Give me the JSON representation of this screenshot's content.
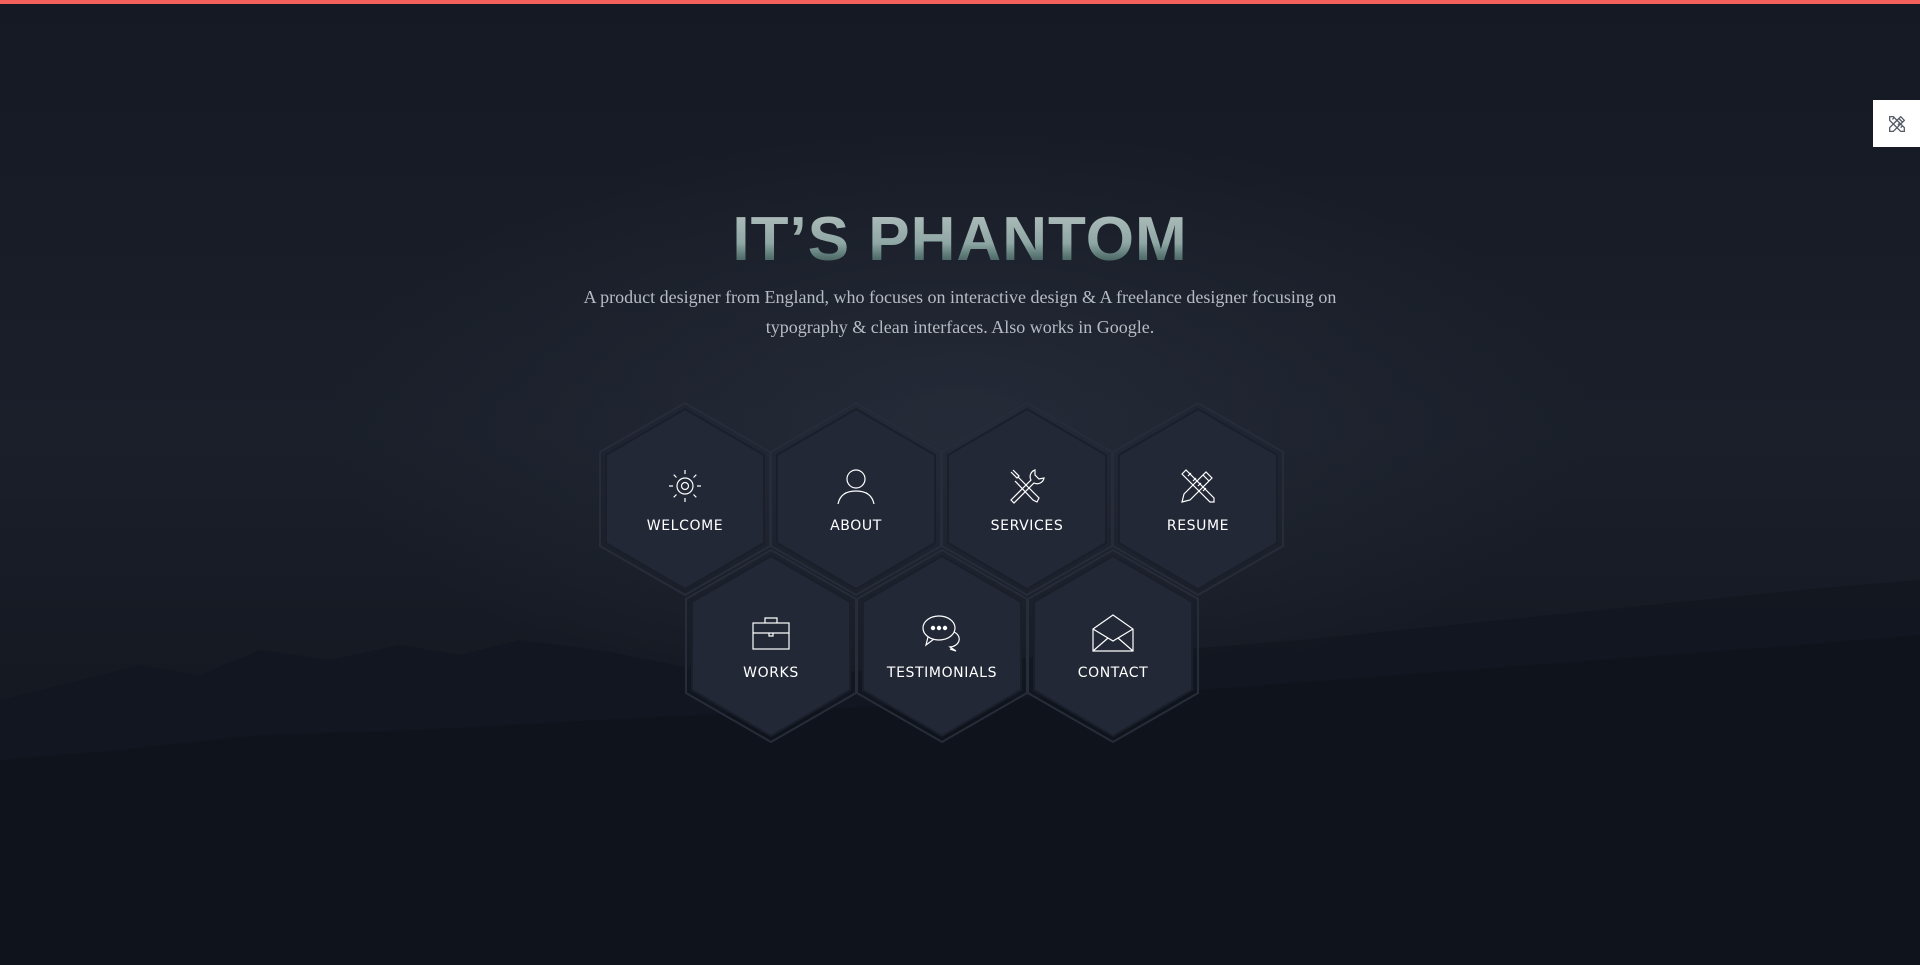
{
  "hero": {
    "title": "IT’S PHANTOM",
    "subtitle": "A product designer from England, who focuses on interactive design & A freelance designer focusing on typography & clean interfaces. Also works in Google."
  },
  "nav": {
    "items": [
      {
        "label": "WELCOME",
        "icon": "sun-icon"
      },
      {
        "label": "ABOUT",
        "icon": "user-icon"
      },
      {
        "label": "SERVICES",
        "icon": "tools-icon"
      },
      {
        "label": "RESUME",
        "icon": "pencil-ruler-icon"
      },
      {
        "label": "WORKS",
        "icon": "briefcase-icon"
      },
      {
        "label": "TESTIMONIALS",
        "icon": "chat-bubbles-icon"
      },
      {
        "label": "CONTACT",
        "icon": "envelope-icon"
      }
    ]
  },
  "colors": {
    "accent": "#f2615b",
    "background": "#141823",
    "hex_fill": "#222836",
    "hex_border": "#2c3342"
  },
  "side_toggle": {
    "icon": "pencil-ruler-icon"
  }
}
